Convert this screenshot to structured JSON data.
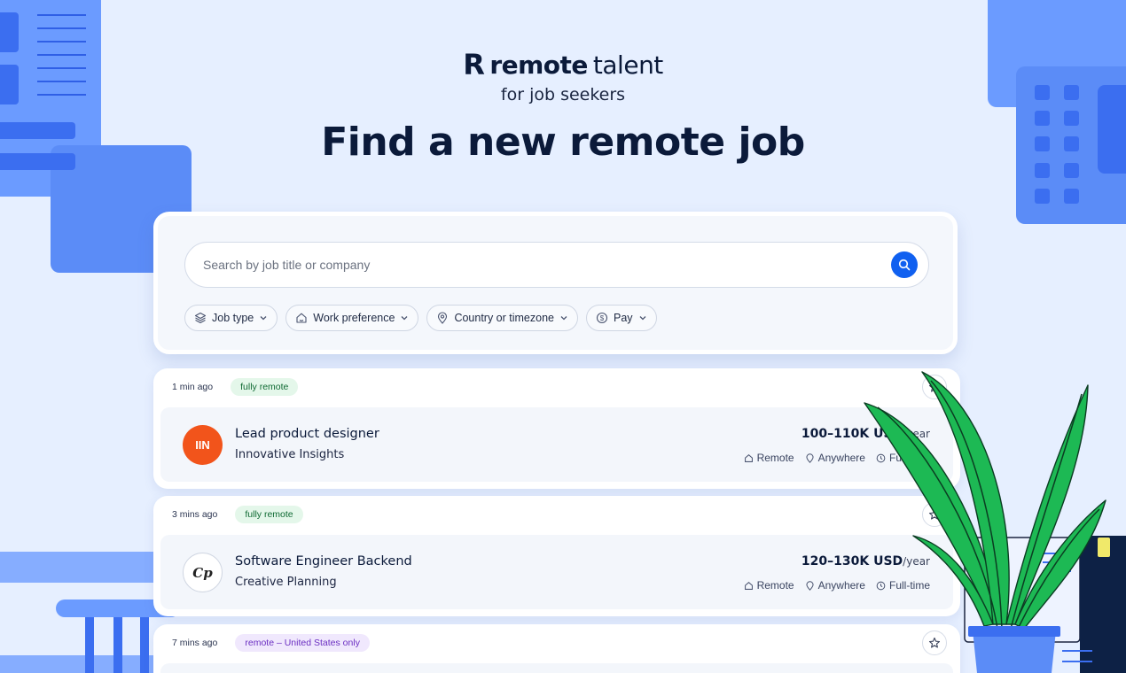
{
  "brand": {
    "logo_glyph": "R",
    "name_bold": "remote",
    "name_light": "talent",
    "subtitle": "for job seekers"
  },
  "hero": {
    "title": "Find a new remote job"
  },
  "search": {
    "placeholder": "Search by job title or company",
    "value": "",
    "button_icon": "search-icon"
  },
  "filters": [
    {
      "label": "Job type",
      "icon": "layers-icon"
    },
    {
      "label": "Work preference",
      "icon": "home-icon"
    },
    {
      "label": "Country or timezone",
      "icon": "map-pin-icon"
    },
    {
      "label": "Pay",
      "icon": "dollar-icon"
    }
  ],
  "jobs": [
    {
      "posted": "1 min ago",
      "tag": "fully remote",
      "logo_text": "IIN",
      "title": "Lead product designer",
      "company": "Innovative Insights",
      "salary": "100–110K USD",
      "salary_period": "/year",
      "work_mode": "Remote",
      "location": "Anywhere",
      "job_type": "Full-time"
    },
    {
      "posted": "3 mins ago",
      "tag": "fully remote",
      "logo_text": "Cp",
      "title": "Software Engineer Backend",
      "company": "Creative Planning",
      "salary": "120–130K USD",
      "salary_period": "/year",
      "work_mode": "Remote",
      "location": "Anywhere",
      "job_type": "Full-time"
    },
    {
      "posted": "7 mins ago",
      "tag": "remote – United States only"
    }
  ],
  "colors": {
    "background": "#e6efff",
    "accent": "#1060f0",
    "heading": "#0b1a3a",
    "decor_blue": "#6b9bff",
    "iin_orange": "#f2541b",
    "plant_green": "#1db954"
  }
}
